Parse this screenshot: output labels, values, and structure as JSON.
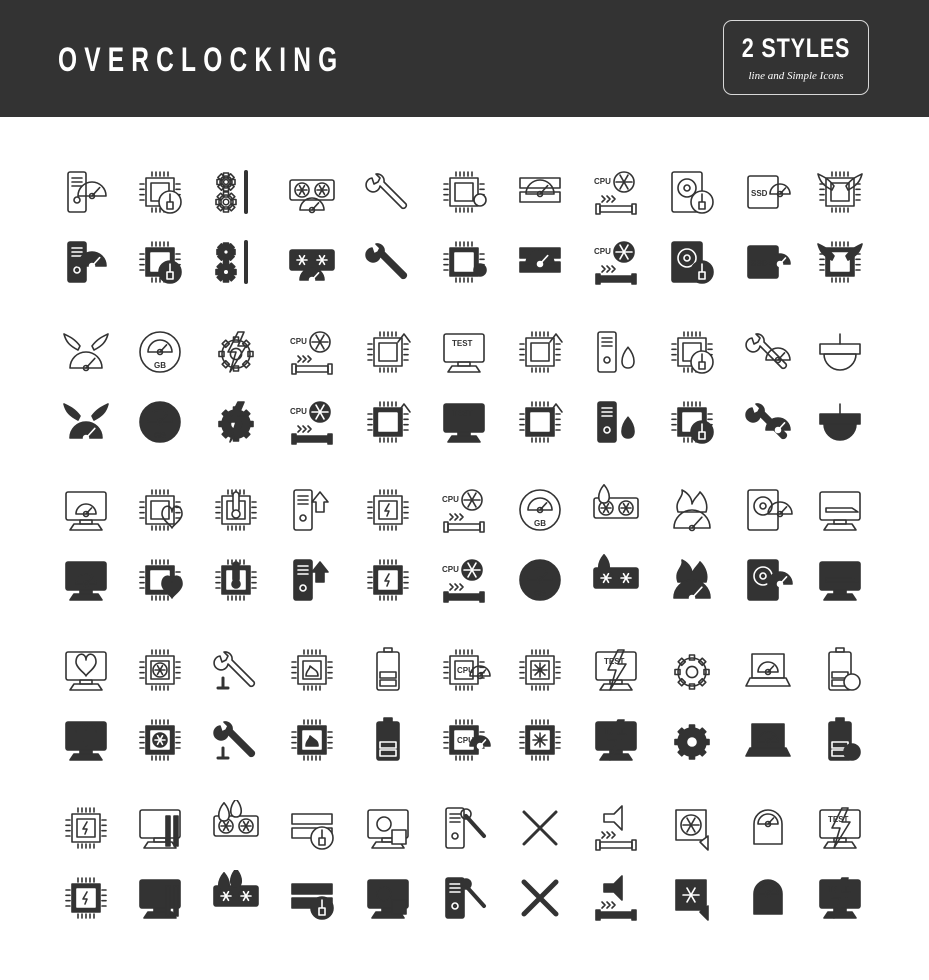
{
  "header": {
    "title": "OVERCLOCKING",
    "background": "#333333",
    "badge": {
      "main": "2 STYLES",
      "sub": "line and Simple Icons"
    }
  },
  "colors": {
    "icon": "#333333",
    "page_background": "#ffffff"
  },
  "icon_sets": [
    {
      "icons": [
        "pc-tower-gauge",
        "cpu-thermal-paste",
        "gears-wrench",
        "gpu-gauge",
        "wrench",
        "cpu-wrench",
        "ram-speedometer",
        "cpu-fan-pipe",
        "hdd-brush",
        "ssd-gauge",
        "cpu-wings"
      ]
    },
    {
      "icons": [
        "winged-speedometer",
        "gb-gauge",
        "gear-lightning",
        "cpu-power-pipe",
        "cpu-arrow-up",
        "test-monitor",
        "cpu-wrench-arrow",
        "pc-tower-coolant",
        "cpu-brush",
        "wrench-gauge",
        "router-gauge"
      ]
    },
    {
      "icons": [
        "monitor-speedometer",
        "cpu-heart",
        "cpu-thermometer",
        "pc-tower-arrow-up",
        "cpu-muscle",
        "cpu-temperature-pipe",
        "gb-speedometer",
        "coolant-fan",
        "fire-speedometer",
        "hdd-gauge",
        "monitor-race-car"
      ]
    },
    {
      "icons": [
        "monitor-heart",
        "cpu-fan",
        "wrench-screw",
        "cpu-flame",
        "battery-half",
        "cpu-gauge",
        "cpu-snowflake",
        "test-monitor-lightning",
        "gear-chip",
        "laptop-speedometer",
        "battery-eco"
      ]
    },
    {
      "icons": [
        "cpu-lightning",
        "pc-tools",
        "coolant-dual-fan",
        "ram-brush",
        "monitor-disc",
        "pc-tower-wrench",
        "tools-crossed",
        "speaker-pipe",
        "fan-mute",
        "head-gauge-chip",
        "test-lightning-chip"
      ]
    }
  ]
}
